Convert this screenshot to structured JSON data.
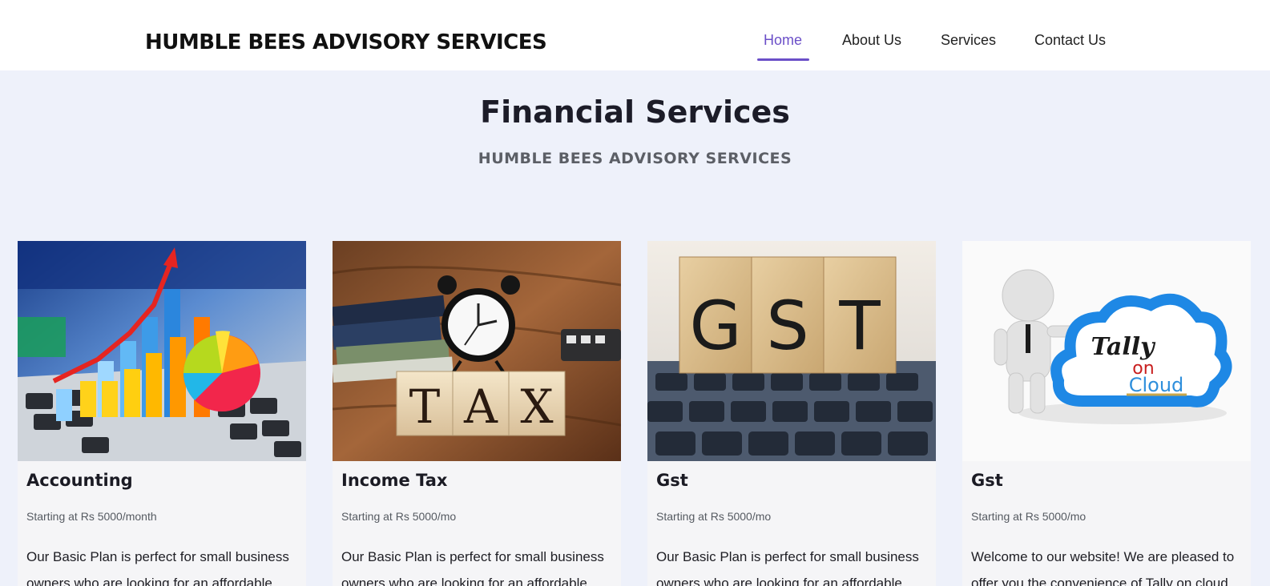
{
  "header": {
    "brand": "HUMBLE BEES ADVISORY SERVICES",
    "nav": [
      {
        "label": "Home",
        "active": true
      },
      {
        "label": "About Us",
        "active": false
      },
      {
        "label": "Services",
        "active": false
      },
      {
        "label": "Contact Us",
        "active": false
      }
    ]
  },
  "hero": {
    "title": "Financial Services",
    "subtitle": "HUMBLE BEES ADVISORY SERVICES"
  },
  "cards": [
    {
      "image": "accounting-chart-image",
      "title": "Accounting",
      "price": "Starting at Rs 5000/month",
      "description": "Our Basic Plan is perfect for small business owners who are looking for an affordable"
    },
    {
      "image": "tax-clock-image",
      "image_text": "TAX",
      "title": "Income Tax",
      "price": "Starting at Rs 5000/mo",
      "description": "Our Basic Plan is perfect for small business owners who are looking for an affordable"
    },
    {
      "image": "gst-blocks-image",
      "image_text": "GST",
      "title": "Gst",
      "price": "Starting at Rs 5000/mo",
      "description": "Our Basic Plan is perfect for small business owners who are looking for an affordable"
    },
    {
      "image": "tally-on-cloud-image",
      "image_text": [
        "Tally",
        "on",
        "Cloud"
      ],
      "title": "Gst",
      "price": "Starting at Rs 5000/mo",
      "description": "Welcome to our website! We are pleased to offer you the convenience of Tally on cloud"
    }
  ],
  "colors": {
    "accent": "#6b4fc8",
    "page_background": "#eef1fa",
    "card_background": "#f5f5f7"
  }
}
